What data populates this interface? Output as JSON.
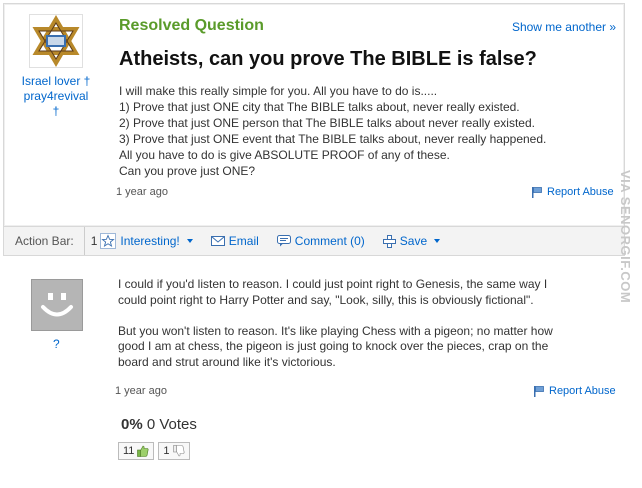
{
  "question": {
    "status": "Resolved Question",
    "show_me_another": "Show me another »",
    "title": "Atheists, can you prove The BIBLE is false?",
    "asker": {
      "name_line1": "Israel lover †",
      "name_line2": "pray4revival",
      "name_line3": "†"
    },
    "body": [
      "I will make this really simple for you. All you have to do is.....",
      "1) Prove that just ONE city that The BIBLE talks about, never really existed.",
      "2) Prove that just ONE person that The BIBLE talks about never really existed.",
      "3) Prove that just ONE event that The BIBLE talks about, never really happened.",
      "All you have to do is give ABSOLUTE PROOF of any of these.",
      "Can you prove just ONE?"
    ],
    "timestamp": "1 year ago",
    "report_label": "Report Abuse"
  },
  "action_bar": {
    "label": "Action Bar:",
    "interesting_count": "1",
    "interesting_label": "Interesting!",
    "email_label": "Email",
    "comment_label": "Comment (0)",
    "save_label": "Save"
  },
  "answer": {
    "avatar_caption": "?",
    "paragraph1": [
      "I could if you'd listen to reason. I could just point right to Genesis, the same way I",
      "could point right to Harry Potter and say, \"Look, silly, this is obviously fictional\"."
    ],
    "paragraph2": [
      "But you won't listen to reason. It's like playing Chess with a pigeon; no matter how",
      "good I am at chess, the pigeon is just going to knock over the pieces, crap on the",
      "board and strut around like it's victorious."
    ],
    "timestamp": "1 year ago",
    "report_label": "Report Abuse",
    "vote_percent": "0%",
    "vote_text": "0 Votes",
    "thumbs_up_count": "11",
    "thumbs_down_count": "1"
  },
  "watermark": "VIA SENORGIF.COM",
  "colors": {
    "link": "#0066cc",
    "resolved_green": "#5a9b2a",
    "border": "#d8d8d8",
    "action_bar_bg": "#f3f3f3"
  }
}
